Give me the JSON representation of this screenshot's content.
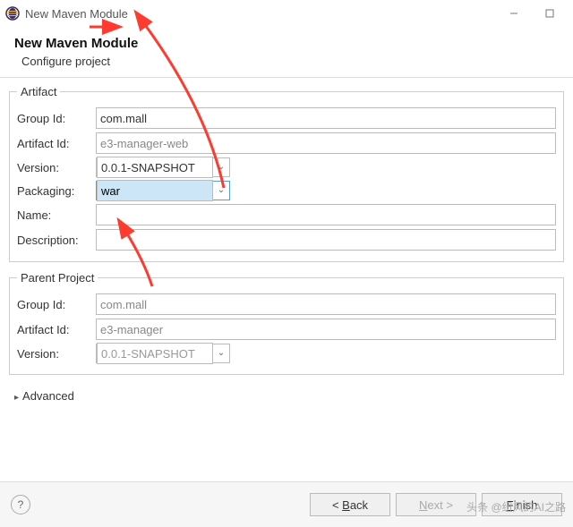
{
  "window": {
    "title": "New Maven Module",
    "minimize_tooltip": "Minimize",
    "maximize_tooltip": "Maximize"
  },
  "header": {
    "title": "New Maven Module",
    "subtitle": "Configure project"
  },
  "artifact": {
    "legend": "Artifact",
    "group_id_label": "Group Id:",
    "group_id_value": "com.mall",
    "artifact_id_label": "Artifact Id:",
    "artifact_id_value": "e3-manager-web",
    "version_label": "Version:",
    "version_value": "0.0.1-SNAPSHOT",
    "packaging_label": "Packaging:",
    "packaging_value": "war",
    "name_label": "Name:",
    "name_value": "",
    "description_label": "Description:",
    "description_value": ""
  },
  "parent": {
    "legend": "Parent Project",
    "group_id_label": "Group Id:",
    "group_id_value": "com.mall",
    "artifact_id_label": "Artifact Id:",
    "artifact_id_value": "e3-manager",
    "version_label": "Version:",
    "version_value": "0.0.1-SNAPSHOT"
  },
  "advanced_label": "Advanced",
  "buttons": {
    "back": "< Back",
    "next": "Next >",
    "finish": "Finish"
  },
  "watermark": "头条 @纽风的AI之路"
}
